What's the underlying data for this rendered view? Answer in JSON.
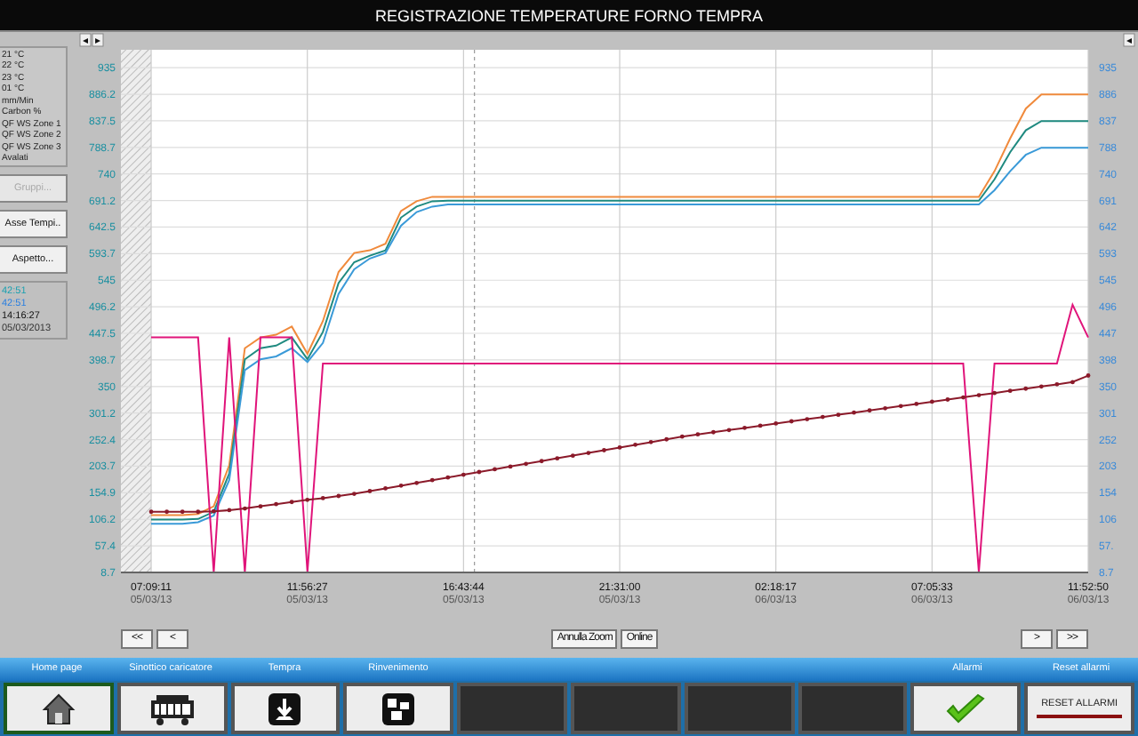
{
  "window": {
    "title": "REGISTRAZIONE TEMPERATURE FORNO TEMPRA"
  },
  "legend": [
    "21 °C",
    "22 °C",
    "23 °C",
    "01 °C",
    "mm/Min",
    "Carbon %",
    "QF WS Zone 1",
    "QF WS Zone 2",
    "QF WS Zone 3",
    "Avalati"
  ],
  "side_buttons": [
    {
      "label": "Gruppi...",
      "disabled": true
    },
    {
      "label": "Asse Tempi..",
      "disabled": false
    },
    {
      "label": "Aspetto...",
      "disabled": false
    }
  ],
  "info": [
    {
      "text": "42:51",
      "color": "#1aa0b0"
    },
    {
      "text": "42:51",
      "color": "#2a7fe0"
    },
    {
      "text": "14:16:27",
      "color": "#111111"
    },
    {
      "text": "05/03/2013",
      "color": "#333333"
    }
  ],
  "scroll_left": [
    "◂",
    "▸"
  ],
  "scroll_right": [
    "◂"
  ],
  "right_axis_labels": [
    "935",
    "886",
    "837",
    "788",
    "740",
    "691",
    "642",
    "593",
    "545",
    "496",
    "447",
    "398",
    "350",
    "301",
    "252",
    "203",
    "154",
    "106",
    "57.",
    "8.7"
  ],
  "chart": {
    "chart_data": {
      "type": "line",
      "grid": true,
      "ylim": [
        8.7,
        967.9
      ],
      "categories": [
        "07:09:11 05/03/13",
        null,
        null,
        null,
        null,
        null,
        null,
        null,
        null,
        null,
        "11:56:27 05/03/13",
        null,
        null,
        null,
        null,
        null,
        null,
        null,
        null,
        null,
        "16:43:44 05/03/13",
        null,
        null,
        null,
        null,
        null,
        null,
        null,
        null,
        null,
        "21:31:00 05/03/13",
        null,
        null,
        null,
        null,
        null,
        null,
        null,
        null,
        null,
        "02:18:17 06/03/13",
        null,
        null,
        null,
        null,
        null,
        null,
        null,
        null,
        null,
        "07:05:33 06/03/13",
        null,
        null,
        null,
        null,
        null,
        null,
        null,
        null,
        null,
        "11:52:50 06/03/13"
      ],
      "yticks": [
        {
          "value": 8.7,
          "label": "8.7"
        },
        {
          "value": 57.4,
          "label": "57.4"
        },
        {
          "value": 106.2,
          "label": "106.2"
        },
        {
          "value": 154.9,
          "label": "154.9"
        },
        {
          "value": 203.7,
          "label": "203.7"
        },
        {
          "value": 252.4,
          "label": "252.4"
        },
        {
          "value": 301.2,
          "label": "301.2"
        },
        {
          "value": 350,
          "label": "350"
        },
        {
          "value": 398.7,
          "label": "398.7"
        },
        {
          "value": 447.5,
          "label": "447.5"
        },
        {
          "value": 496.2,
          "label": "496.2"
        },
        {
          "value": 545,
          "label": "545"
        },
        {
          "value": 593.7,
          "label": "593.7"
        },
        {
          "value": 642.5,
          "label": "642.5"
        },
        {
          "value": 691.2,
          "label": "691.2"
        },
        {
          "value": 740,
          "label": "740"
        },
        {
          "value": 788.7,
          "label": "788.7"
        },
        {
          "value": 837.5,
          "label": "837.5"
        },
        {
          "value": 886.2,
          "label": "886.2"
        },
        {
          "value": 935,
          "label": "935"
        }
      ],
      "series": [
        {
          "color": "#f08a3c",
          "values": [
            114,
            114,
            114,
            116,
            130,
            205,
            420,
            440,
            445,
            460,
            410,
            470,
            560,
            595,
            600,
            612,
            672,
            690,
            698,
            698,
            698,
            698,
            698,
            698,
            698,
            698,
            698,
            698,
            698,
            698,
            698,
            698,
            698,
            698,
            698,
            698,
            698,
            698,
            698,
            698,
            698,
            698,
            698,
            698,
            698,
            698,
            698,
            698,
            698,
            698,
            698,
            698,
            698,
            698,
            745,
            805,
            860,
            886,
            886,
            886,
            886
          ]
        },
        {
          "color": "#1f8a80",
          "values": [
            106,
            106,
            106,
            107,
            120,
            190,
            400,
            420,
            425,
            440,
            400,
            450,
            540,
            578,
            590,
            600,
            660,
            680,
            690,
            691,
            691,
            691,
            691,
            691,
            691,
            691,
            691,
            691,
            691,
            691,
            691,
            691,
            691,
            691,
            691,
            691,
            691,
            691,
            691,
            691,
            691,
            691,
            691,
            691,
            691,
            691,
            691,
            691,
            691,
            691,
            691,
            691,
            691,
            691,
            730,
            780,
            820,
            837,
            837,
            837,
            837
          ]
        },
        {
          "color": "#3a9ad8",
          "values": [
            98,
            98,
            98,
            101,
            113,
            178,
            380,
            400,
            405,
            420,
            395,
            430,
            520,
            565,
            585,
            595,
            645,
            670,
            680,
            684,
            684,
            684,
            684,
            684,
            684,
            684,
            684,
            684,
            684,
            684,
            684,
            684,
            684,
            684,
            684,
            684,
            684,
            684,
            684,
            684,
            684,
            684,
            684,
            684,
            684,
            684,
            684,
            684,
            684,
            684,
            684,
            684,
            684,
            684,
            710,
            745,
            775,
            788,
            788,
            788,
            788
          ]
        },
        {
          "color": "#e0147a",
          "values": [
            440,
            440,
            440,
            440,
            9,
            440,
            9,
            440,
            440,
            440,
            9,
            392,
            392,
            392,
            392,
            392,
            392,
            392,
            392,
            392,
            392,
            392,
            392,
            392,
            392,
            392,
            392,
            392,
            392,
            392,
            392,
            392,
            392,
            392,
            392,
            392,
            392,
            392,
            392,
            392,
            392,
            392,
            392,
            392,
            392,
            392,
            392,
            392,
            392,
            392,
            392,
            392,
            392,
            9,
            392,
            392,
            392,
            392,
            392,
            500,
            440
          ]
        },
        {
          "color": "#8b1a2a",
          "values": [
            120,
            120,
            120,
            120,
            121,
            123,
            126,
            130,
            134,
            138,
            142,
            145,
            149,
            153,
            158,
            163,
            168,
            173,
            178,
            183,
            188,
            193,
            198,
            203,
            208,
            213,
            218,
            223,
            228,
            233,
            238,
            243,
            248,
            253,
            258,
            262,
            266,
            270,
            274,
            278,
            282,
            286,
            290,
            294,
            298,
            302,
            306,
            310,
            314,
            318,
            322,
            326,
            330,
            334,
            338,
            342,
            346,
            350,
            354,
            358,
            370
          ]
        }
      ]
    }
  },
  "nav_buttons": [
    {
      "label": "<<",
      "kind": "left"
    },
    {
      "label": "<",
      "kind": "left"
    },
    {
      "label": "Annulla Zoom",
      "kind": "center"
    },
    {
      "label": "Online",
      "kind": "center"
    },
    {
      "label": ">",
      "kind": "right"
    },
    {
      "label": ">>",
      "kind": "right"
    }
  ],
  "function_keys": [
    {
      "kind": "home",
      "label": "Home page",
      "selected": true
    },
    {
      "kind": "furnace",
      "label": "Sinottico caricatore",
      "selected": false
    },
    {
      "kind": "download",
      "label": "Tempra",
      "selected": false
    },
    {
      "kind": "layout",
      "label": "Rinvenimento",
      "selected": false
    },
    {
      "kind": "empty",
      "selected": false
    },
    {
      "kind": "empty",
      "selected": false
    },
    {
      "kind": "empty",
      "selected": false
    },
    {
      "kind": "empty",
      "selected": false
    },
    {
      "kind": "check",
      "label": "Allarmi",
      "selected": false
    },
    {
      "kind": "reset",
      "label": "Reset allarmi",
      "text": "RESET ALLARMI",
      "selected": false
    }
  ]
}
